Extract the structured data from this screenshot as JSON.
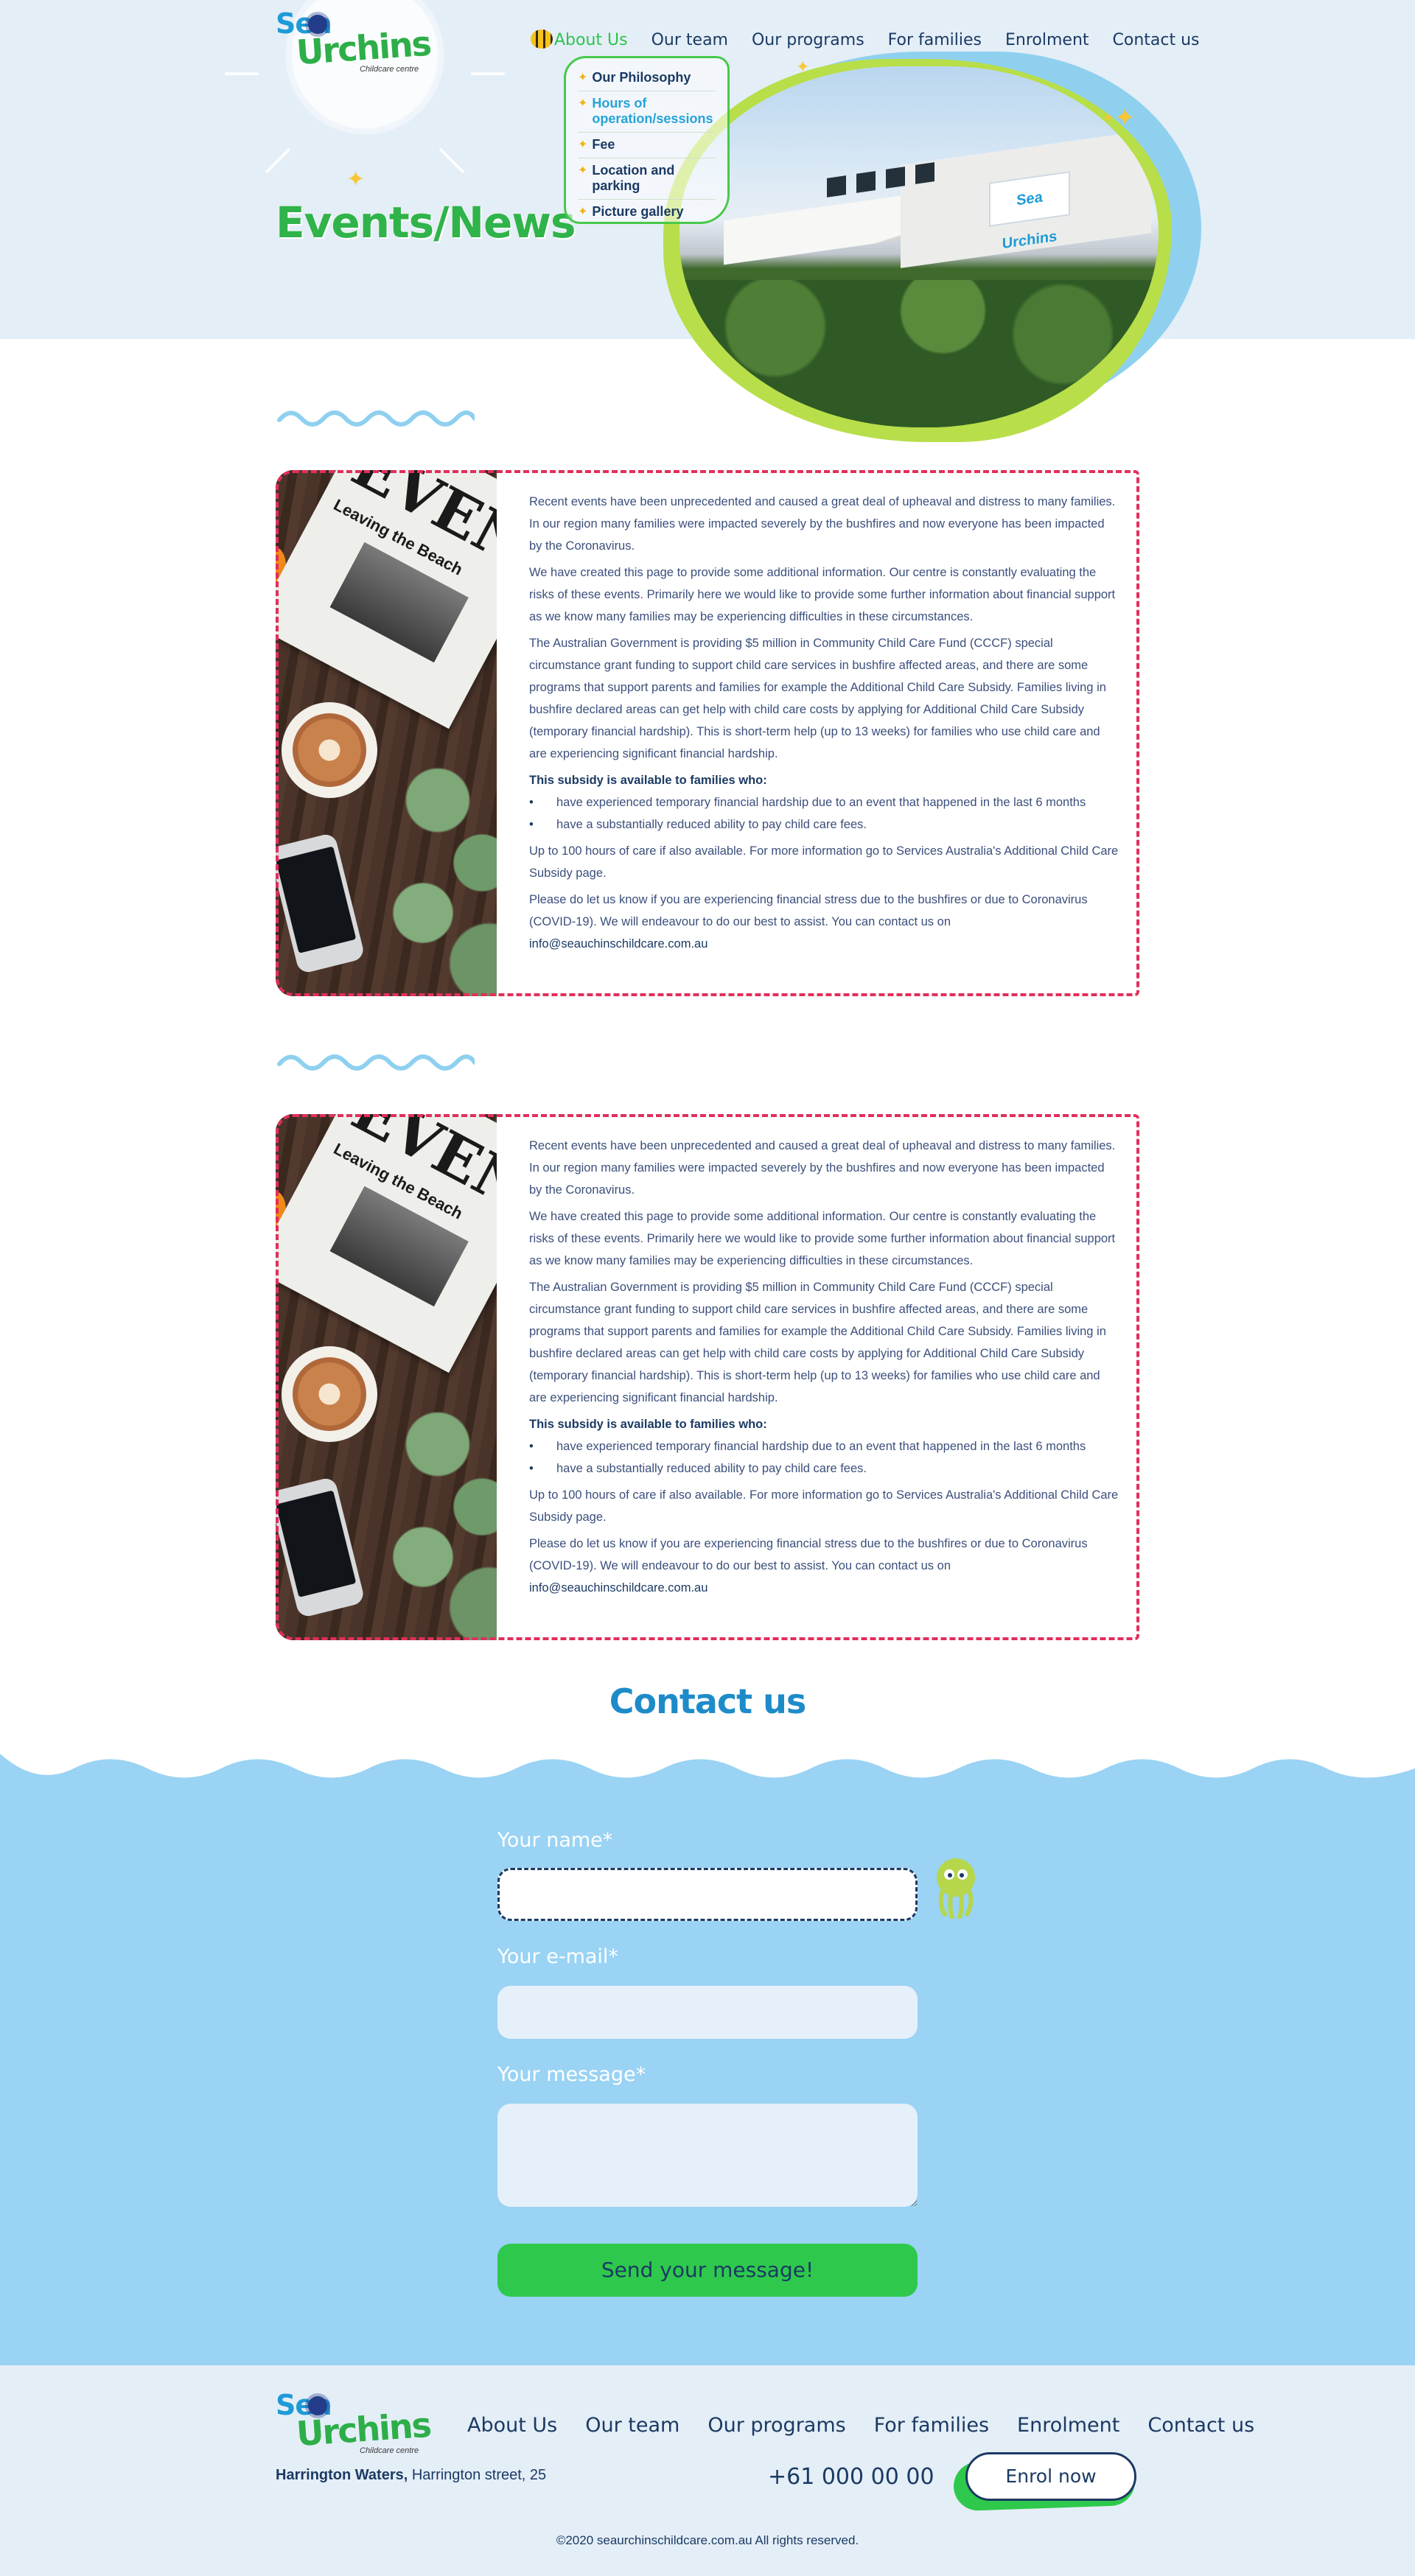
{
  "logo": {
    "line1": "Sea",
    "line2": "Urchins",
    "tagline": "Childcare centre"
  },
  "nav": {
    "items": [
      "About Us",
      "Our team",
      "Our programs",
      "For families",
      "Enrolment",
      "Contact us"
    ]
  },
  "submenu": {
    "items": [
      "Our Philosophy",
      "Hours of operation/sessions",
      "Fee",
      "Location and parking",
      "Picture gallery"
    ]
  },
  "hero": {
    "title": "Events/News",
    "sign_text": "Sea Urchins"
  },
  "newspaper": {
    "headline": "EVEN",
    "subheadline": "Leaving the Beach"
  },
  "article": {
    "p1": "Recent events have been unprecedented and caused a great deal of upheaval and distress to many families. In our region many families were impacted severely by the bushfires and now everyone has been impacted by the Coronavirus.",
    "p2": "We have created this page to provide some additional information. Our centre is constantly evaluating the risks of these events. Primarily here we would like to provide some further information about financial support as we know many families may be experiencing difficulties in these circumstances.",
    "p3": "The Australian Government is providing $5 million in Community Child Care Fund (CCCF) special circumstance grant funding to support child care services in bushfire affected areas, and there are some programs that support parents and families for example the Additional Child Care Subsidy. Families living in bushfire declared areas can get help with child care costs by applying for Additional Child Care Subsidy (temporary financial hardship). This is short-term help (up to 13 weeks) for families who use child care and are experiencing significant financial hardship.",
    "subsidy_heading": "This subsidy is available to families who:",
    "bullet1": "have experienced temporary financial hardship due to an event that happened in the last 6 months",
    "bullet2": "have a substantially reduced ability to pay child care fees.",
    "p4": "Up to 100 hours of care if also available. For more information go to Services Australia's Additional Child Care Subsidy page.",
    "p5": "Please do let us know if you are experiencing financial stress due to the bushfires or due to Coronavirus (COVID-19). We will endeavour to do our best to assist. You can contact us on",
    "email": "info@seauchinschildcare.com.au"
  },
  "contact": {
    "title": "Contact us",
    "name_label": "Your name*",
    "email_label": "Your e-mail*",
    "message_label": "Your message*",
    "name_value": "",
    "email_value": "",
    "message_value": "",
    "send_label": "Send your message!"
  },
  "footer": {
    "nav": [
      "About Us",
      "Our team",
      "Our programs",
      "For families",
      "Enrolment",
      "Contact us"
    ],
    "address_bold": "Harrington Waters,",
    "address_rest": " Harrington street, 25",
    "phone": "+61 000 00 00",
    "enrol_label": "Enrol now",
    "copyright": "©2020 seaurchinschildcare.com.au All rights reserved."
  },
  "colors": {
    "accent_green": "#2ec94c",
    "title_green": "#2fb34a",
    "navy": "#1b3a63",
    "sky_blue": "#9ad3f3",
    "card_border": "#e22e5b",
    "contact_title": "#1e8bc9"
  }
}
